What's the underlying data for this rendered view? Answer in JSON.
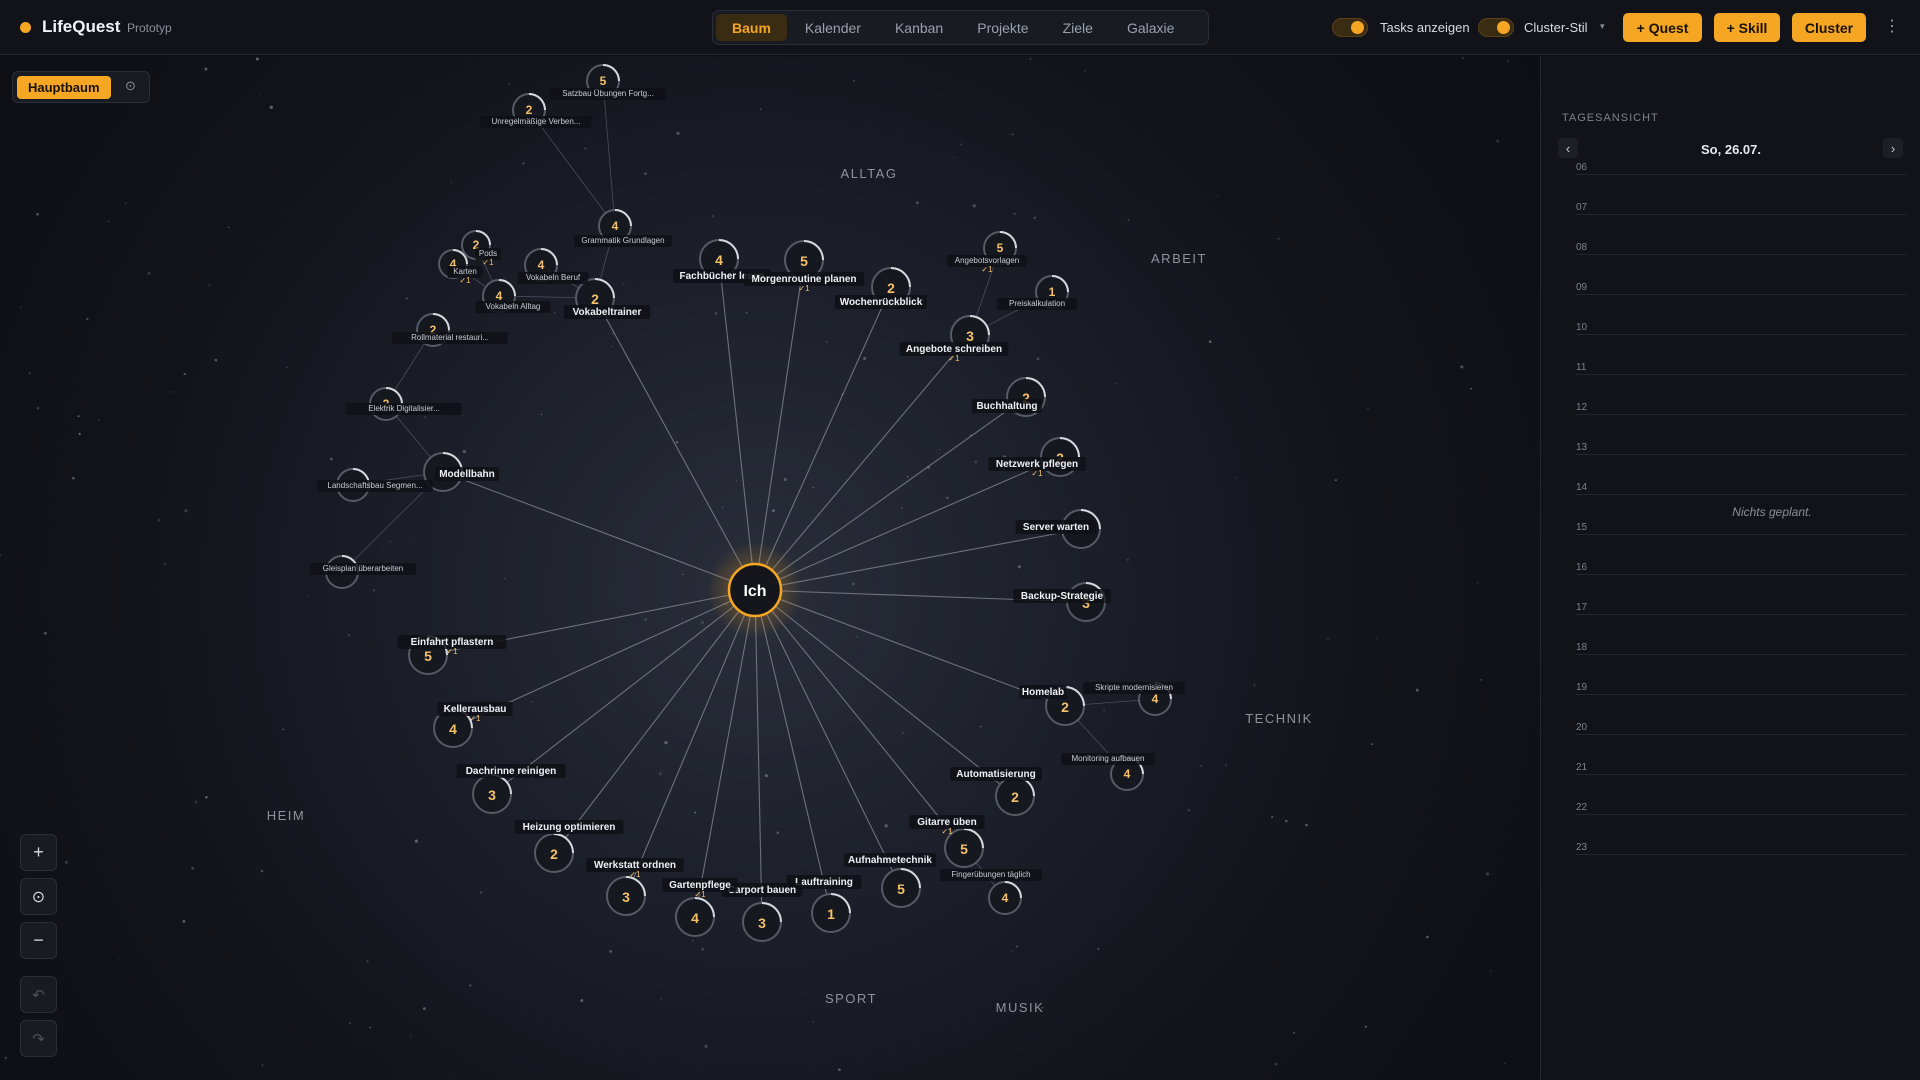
{
  "app": {
    "name": "LifeQuest",
    "tag": "Prototyp"
  },
  "tabs": [
    "Baum",
    "Kalender",
    "Kanban",
    "Projekte",
    "Ziele",
    "Galaxie"
  ],
  "active_tab": "Baum",
  "toggles": {
    "tasks": "Tasks anzeigen",
    "cluster": "Cluster-Stil"
  },
  "buttons": {
    "quest": "+ Quest",
    "skill": "+ Skill",
    "cluster": "Cluster"
  },
  "tree_selector": "Hauptbaum",
  "center_label": "Ich",
  "clusters": [
    "ALLTAG",
    "ARBEIT",
    "TECHNIK",
    "MUSIK",
    "SPORT",
    "HEIM"
  ],
  "nodes": [
    {
      "id": "n1",
      "label": "Fachbücher lesen",
      "level": "4",
      "check": ""
    },
    {
      "id": "n2",
      "label": "Morgenroutine planen",
      "level": "5",
      "check": "✓1"
    },
    {
      "id": "n3",
      "label": "Wochenrückblick",
      "level": "2",
      "check": ""
    },
    {
      "id": "n4",
      "label": "Angebotsvorlagen",
      "level": "5",
      "check": "✓1"
    },
    {
      "id": "n5",
      "label": "Preiskalkulation",
      "level": "1",
      "check": ""
    },
    {
      "id": "n6",
      "label": "Angebote schreiben",
      "level": "3",
      "check": "✓1"
    },
    {
      "id": "n7",
      "label": "Buchhaltung",
      "level": "2",
      "check": ""
    },
    {
      "id": "n8",
      "label": "Netzwerk pflegen",
      "level": "2",
      "check": "✓1"
    },
    {
      "id": "n9",
      "label": "Server warten",
      "level": "",
      "check": ""
    },
    {
      "id": "n10",
      "label": "Backup-Strategie",
      "level": "3",
      "check": ""
    },
    {
      "id": "n11",
      "label": "Homelab",
      "level": "2",
      "check": ""
    },
    {
      "id": "n12",
      "label": "Skripte modernisieren",
      "level": "4",
      "check": ""
    },
    {
      "id": "n13",
      "label": "Monitoring aufbauen",
      "level": "4",
      "check": ""
    },
    {
      "id": "n14",
      "label": "Automatisierung",
      "level": "2",
      "check": ""
    },
    {
      "id": "n15",
      "label": "Gitarre üben",
      "level": "5",
      "check": "✓1"
    },
    {
      "id": "n16",
      "label": "Fingerübungen täglich",
      "level": "4",
      "check": ""
    },
    {
      "id": "n17",
      "label": "Aufnahmetechnik",
      "level": "5",
      "check": ""
    },
    {
      "id": "n18",
      "label": "Lauftraining",
      "level": "1",
      "check": ""
    },
    {
      "id": "n19",
      "label": "Carport bauen",
      "level": "3",
      "check": ""
    },
    {
      "id": "n20",
      "label": "Gartenpflege",
      "level": "4",
      "check": "✓1"
    },
    {
      "id": "n21",
      "label": "Werkstatt ordnen",
      "level": "3",
      "check": "✓1"
    },
    {
      "id": "n22",
      "label": "Heizung optimieren",
      "level": "2",
      "check": ""
    },
    {
      "id": "n23",
      "label": "Dachrinne reinigen",
      "level": "3",
      "check": ""
    },
    {
      "id": "n24",
      "label": "Kellerausbau",
      "level": "4",
      "check": "✓1"
    },
    {
      "id": "n25",
      "label": "Einfahrt pflastern",
      "level": "5",
      "check": "✓1"
    },
    {
      "id": "n26",
      "label": "Modellbahn",
      "level": "",
      "check": ""
    },
    {
      "id": "n27",
      "label": "Landschaftsbau Segmen...",
      "level": "",
      "check": ""
    },
    {
      "id": "n28",
      "label": "Gleisplan überarbeiten",
      "level": "",
      "check": ""
    },
    {
      "id": "n29",
      "label": "Elektrik Digitalisier...",
      "level": "2",
      "check": ""
    },
    {
      "id": "n30",
      "label": "Rollmaterial restauri...",
      "level": "2",
      "check": ""
    },
    {
      "id": "n31",
      "label": "Vokabeltrainer",
      "level": "2",
      "check": ""
    },
    {
      "id": "n32",
      "label": "Vokabeln Beruf",
      "level": "4",
      "check": ""
    },
    {
      "id": "n33",
      "label": "Vokabeln Alltag",
      "level": "4",
      "check": ""
    },
    {
      "id": "n34",
      "label": "Karten",
      "level": "4",
      "check": "✓1"
    },
    {
      "id": "n35",
      "label": "Pods",
      "level": "2",
      "check": "✓1"
    },
    {
      "id": "n36",
      "label": "Grammatik Grundlagen",
      "level": "4",
      "check": ""
    },
    {
      "id": "n37",
      "label": "Unregelmäßige Verben...",
      "level": "2",
      "check": ""
    },
    {
      "id": "n38",
      "label": "Satzbau Übungen Fortg...",
      "level": "5",
      "check": ""
    }
  ],
  "sidebar": {
    "title": "TAGESANSICHT",
    "date": "So, 26.07.",
    "prev": "‹",
    "next": "›",
    "hours": [
      "06",
      "07",
      "08",
      "09",
      "10",
      "11",
      "12",
      "13",
      "14",
      "15",
      "16",
      "17",
      "18",
      "19",
      "20",
      "21",
      "22",
      "23"
    ],
    "empty": "Nichts geplant."
  },
  "controls": {
    "zoom_in": "+",
    "center": "⊙",
    "zoom_out": "−",
    "undo": "↶",
    "redo": "↷"
  },
  "colors": {
    "accent": "#f5a623",
    "bg": "#0d0f14"
  }
}
